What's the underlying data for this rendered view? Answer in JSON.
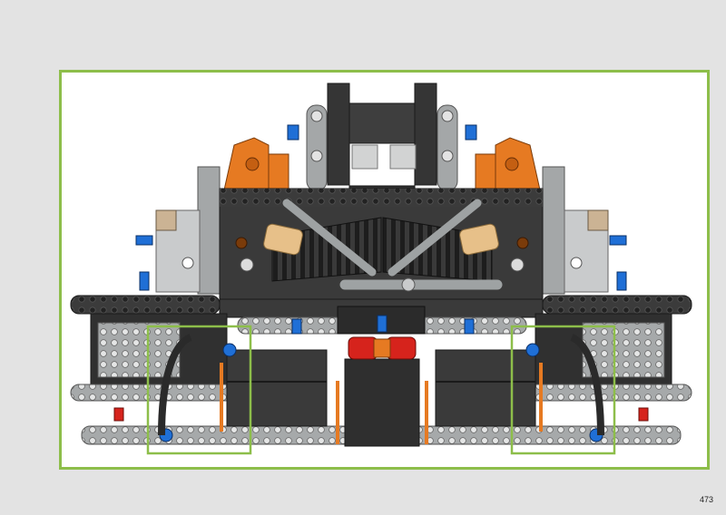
{
  "page": {
    "number": "473"
  },
  "colors": {
    "frame": "#8dbe4a",
    "callout": "#8dbe4a",
    "dark_bg": "#3a3a3a",
    "beam_gray": "#9ea2a3",
    "light_gray": "#c9cbcc",
    "orange": "#e67a22",
    "blue": "#1f6fd6",
    "red": "#d6231c",
    "tan": "#e7c089",
    "dark_tan": "#cbb394"
  },
  "callouts": [
    {
      "name": "left-callout"
    },
    {
      "name": "right-callout"
    }
  ]
}
